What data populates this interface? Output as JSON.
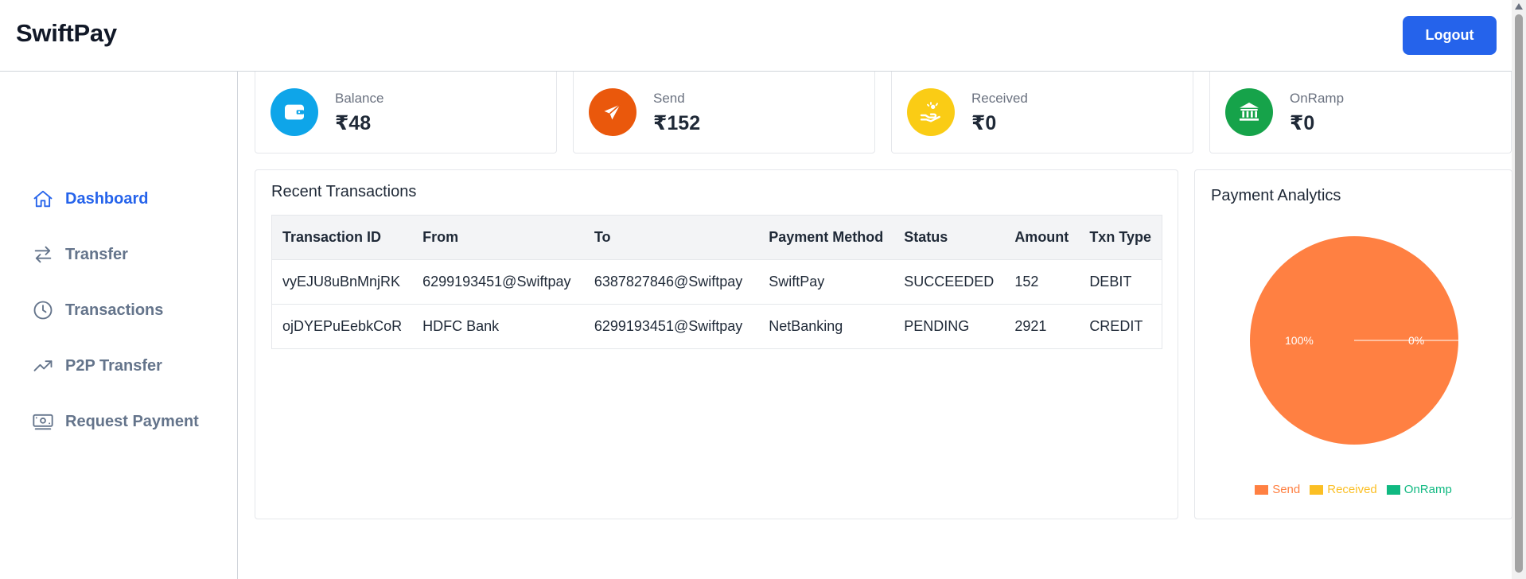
{
  "app": {
    "brand": "SwiftPay",
    "logout_label": "Logout"
  },
  "sidebar": {
    "items": [
      {
        "label": "Dashboard",
        "icon": "home-icon",
        "active": true
      },
      {
        "label": "Transfer",
        "icon": "arrows-exchange-icon",
        "active": false
      },
      {
        "label": "Transactions",
        "icon": "clock-icon",
        "active": false
      },
      {
        "label": "P2P Transfer",
        "icon": "trending-up-icon",
        "active": false
      },
      {
        "label": "Request Payment",
        "icon": "banknote-icon",
        "active": false
      }
    ]
  },
  "cards": [
    {
      "label": "Balance",
      "value": "₹48",
      "icon": "wallet-icon",
      "color": "#0ea5e9"
    },
    {
      "label": "Send",
      "value": "₹152",
      "icon": "send-icon",
      "color": "#ea580c"
    },
    {
      "label": "Received",
      "value": "₹0",
      "icon": "receive-hand-icon",
      "color": "#facc15"
    },
    {
      "label": "OnRamp",
      "value": "₹0",
      "icon": "bank-icon",
      "color": "#16a34a"
    }
  ],
  "transactions": {
    "title": "Recent Transactions",
    "headers": [
      "Transaction ID",
      "From",
      "To",
      "Payment Method",
      "Status",
      "Amount",
      "Txn Type"
    ],
    "rows": [
      [
        "vyEJU8uBnMnjRK",
        "6299193451@Swiftpay",
        "6387827846@Swiftpay",
        "SwiftPay",
        "SUCCEEDED",
        "152",
        "DEBIT"
      ],
      [
        "ojDYEPuEebkCoR",
        "HDFC Bank",
        "6299193451@Swiftpay",
        "NetBanking",
        "PENDING",
        "2921",
        "CREDIT"
      ]
    ],
    "status_colors": {
      "SUCCEEDED": "#22c55e",
      "PENDING": "#eab308"
    }
  },
  "analytics": {
    "title": "Payment Analytics",
    "slice_labels": [
      "100%",
      "0%"
    ]
  },
  "chart_data": {
    "type": "pie",
    "title": "Payment Analytics",
    "categories": [
      "Send",
      "Received",
      "OnRamp"
    ],
    "values": [
      100,
      0,
      0
    ],
    "labels": [
      "100%",
      "0%",
      "0%"
    ],
    "colors": [
      "#ff8042",
      "#fbbf24",
      "#10b981"
    ],
    "legend": "bottom"
  }
}
